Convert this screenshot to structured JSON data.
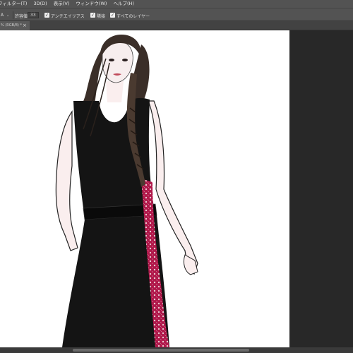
{
  "menubar": {
    "items": [
      "フィルター(T)",
      "3D(D)",
      "表示(V)",
      "ウィンドウ(W)",
      "ヘルプ(H)"
    ]
  },
  "options": {
    "tool_fragment": "A",
    "tolerance_label": "許容値：",
    "tolerance_value": "33",
    "antialias_label": "アンチエイリアス",
    "contiguous_label": "隣接",
    "all_layers_label": "すべてのレイヤー"
  },
  "document": {
    "tab_label": "% (RGB/8) *",
    "close_glyph": "×"
  },
  "colors": {
    "ui_panel": "#535353",
    "workspace": "#282828",
    "dress": "#141414",
    "lace": "#b0174a",
    "hair": "#3a2e28"
  }
}
